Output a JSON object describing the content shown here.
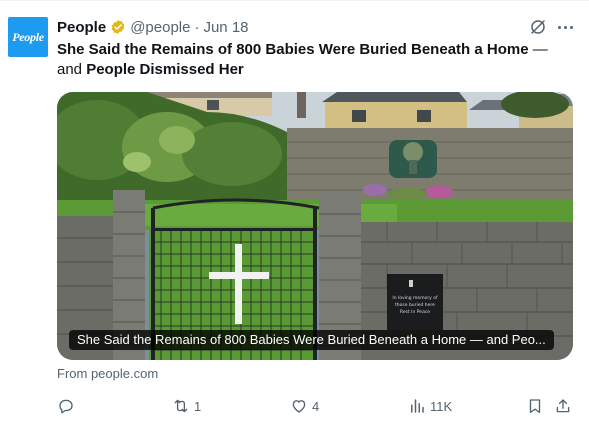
{
  "tweet": {
    "author_name": "People",
    "avatar_text": "People",
    "handle": "@people",
    "separator": "·",
    "date": "Jun 18",
    "text_part1": "She Said the Remains of 800 Babies Were Buried Beneath a Home",
    "text_part2": " — and ",
    "text_part3": "People Dismissed Her"
  },
  "card": {
    "caption": "She Said the Remains of 800 Babies Were Buried Beneath a Home — and Peo...",
    "plaque_lines": [
      "In",
      "loving memory of",
      "those buried here",
      "Rest In Peace"
    ],
    "source": "From people.com"
  },
  "actions": {
    "reply_count": "",
    "repost_count": "1",
    "like_count": "4",
    "views_count": "11K"
  },
  "icons": [
    "verified-badge-icon",
    "grok-icon",
    "more-icon",
    "reply-icon",
    "repost-icon",
    "like-icon",
    "views-icon",
    "bookmark-icon",
    "share-icon"
  ],
  "colors": {
    "brand": "#1d9bf0",
    "text_primary": "#0f1419",
    "text_secondary": "#536471",
    "verified_badge": "#e2b719"
  }
}
